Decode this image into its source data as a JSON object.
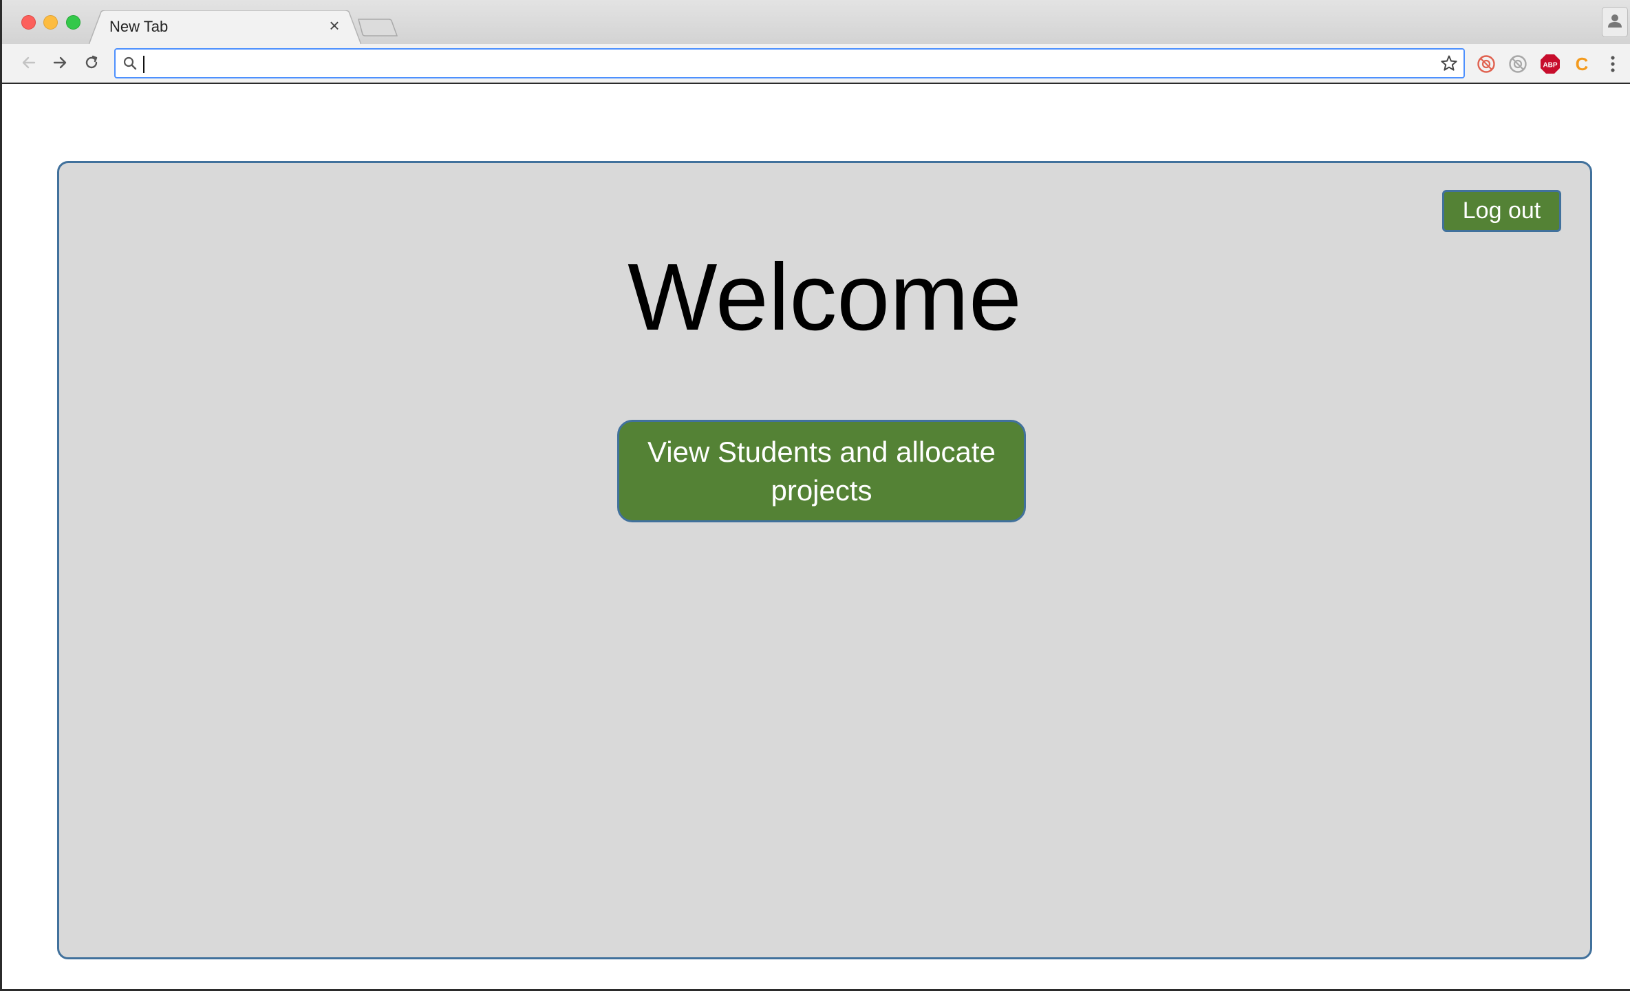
{
  "browser": {
    "tab": {
      "title": "New Tab",
      "close_glyph": "×"
    },
    "address_bar": {
      "value": "",
      "placeholder": ""
    },
    "icons": {
      "back": "arrow-left-icon",
      "forward": "arrow-right-icon",
      "reload": "reload-icon",
      "search": "search-icon",
      "bookmark": "star-icon",
      "profile": "person-icon",
      "menu": "more-vertical-icon"
    },
    "extensions": [
      {
        "name": "ext-red-circle-icon",
        "color": "#e0614f"
      },
      {
        "name": "ext-gray-circle-icon",
        "color": "#a7a7a7"
      },
      {
        "name": "adblock-plus-icon",
        "label": "ABP",
        "color": "#c70d2c"
      },
      {
        "name": "ext-c-icon",
        "label": "C",
        "color": "#f39a1d"
      }
    ]
  },
  "page": {
    "logout_label": "Log out",
    "heading": "Welcome",
    "primary_action_label": "View Students and allocate projects"
  },
  "colors": {
    "panel_bg": "#d9d9d9",
    "panel_border": "#41719c",
    "button_green": "#548235",
    "button_text": "#ffffff",
    "omnibox_focus": "#4d90fe"
  }
}
